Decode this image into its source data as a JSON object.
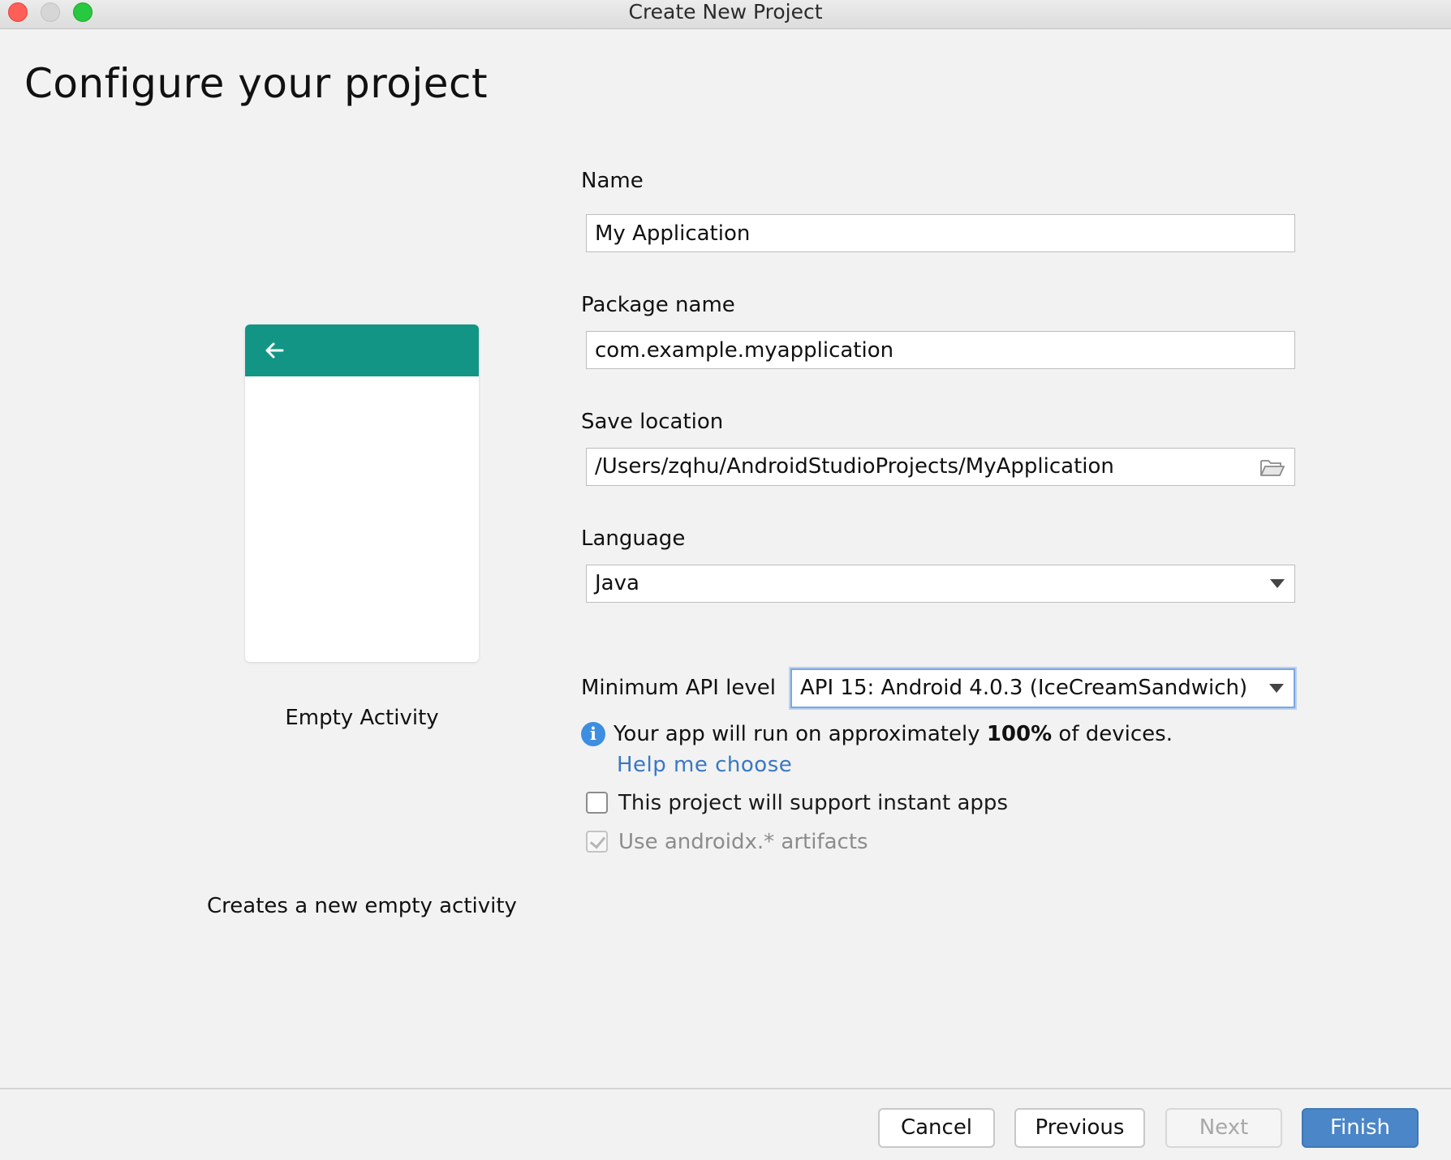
{
  "window": {
    "title": "Create New Project"
  },
  "page": {
    "title": "Configure your project"
  },
  "preview": {
    "template_name": "Empty Activity",
    "description": "Creates a new empty activity",
    "appbar_color": "#139585",
    "back_icon": "arrow-left-icon"
  },
  "form": {
    "name": {
      "label": "Name",
      "value": "My Application"
    },
    "package_name": {
      "label": "Package name",
      "value": "com.example.myapplication"
    },
    "save_location": {
      "label": "Save location",
      "value": "/Users/zqhu/AndroidStudioProjects/MyApplication",
      "icon": "folder-icon"
    },
    "language": {
      "label": "Language",
      "value": "Java"
    },
    "min_api": {
      "label": "Minimum API level",
      "value": "API 15: Android 4.0.3 (IceCreamSandwich)"
    },
    "info": {
      "prefix": "Your app will run on approximately ",
      "percent": "100%",
      "suffix": " of devices.",
      "icon": "info-icon"
    },
    "help_link": "Help me choose",
    "instant_apps": {
      "label": "This project will support instant apps",
      "checked": false
    },
    "androidx": {
      "label": "Use androidx.* artifacts",
      "checked": true,
      "disabled": true
    }
  },
  "buttons": {
    "cancel": "Cancel",
    "previous": "Previous",
    "next": "Next",
    "finish": "Finish"
  },
  "colors": {
    "accent": "#4a86c8",
    "link": "#3a78c2",
    "info": "#3d8ee0"
  }
}
